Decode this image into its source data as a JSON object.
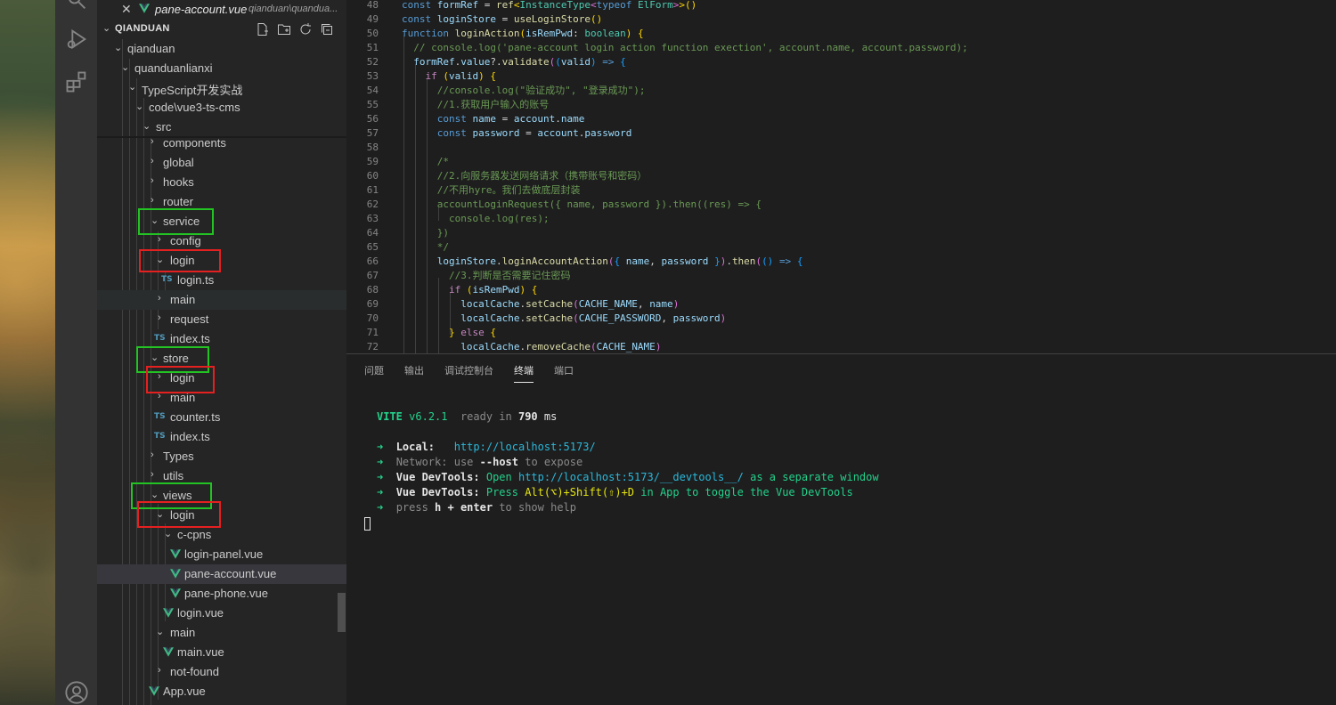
{
  "open_editor": {
    "file_name": "pane-account.vue",
    "file_path": "qianduan\\quandua..."
  },
  "explorer": {
    "root": "QIANDUAN",
    "tree": [
      {
        "label": "qianduan"
      },
      {
        "label": "quanduanlianxi"
      },
      {
        "label": "TypeScript开发实战"
      },
      {
        "label": "code\\vue3-ts-cms"
      },
      {
        "label": "src"
      },
      {
        "label": "components"
      },
      {
        "label": "global"
      },
      {
        "label": "hooks"
      },
      {
        "label": "router"
      },
      {
        "label": "service"
      },
      {
        "label": "config"
      },
      {
        "label": "login"
      },
      {
        "label": "login.ts",
        "icon": "TS"
      },
      {
        "label": "main"
      },
      {
        "label": "request"
      },
      {
        "label": "index.ts",
        "icon": "TS"
      },
      {
        "label": "store"
      },
      {
        "label": "login"
      },
      {
        "label": "main"
      },
      {
        "label": "counter.ts",
        "icon": "TS"
      },
      {
        "label": "index.ts",
        "icon": "TS"
      },
      {
        "label": "Types"
      },
      {
        "label": "utils"
      },
      {
        "label": "views"
      },
      {
        "label": "login"
      },
      {
        "label": "c-cpns"
      },
      {
        "label": "login-panel.vue"
      },
      {
        "label": "pane-account.vue"
      },
      {
        "label": "pane-phone.vue"
      },
      {
        "label": "login.vue"
      },
      {
        "label": "main"
      },
      {
        "label": "main.vue"
      },
      {
        "label": "not-found"
      },
      {
        "label": "App.vue"
      }
    ]
  },
  "editor": {
    "line_numbers": [
      "48",
      "49",
      "50",
      "51",
      "52",
      "53",
      "54",
      "55",
      "56",
      "57",
      "58",
      "59",
      "60",
      "61",
      "62",
      "63",
      "64",
      "65",
      "66",
      "67",
      "68",
      "69",
      "70",
      "71",
      "72"
    ]
  },
  "panel": {
    "tabs": [
      "问题",
      "输出",
      "调试控制台",
      "终端",
      "端口"
    ],
    "active_tab": "终端"
  },
  "terminal": {
    "vite": "VITE",
    "version": "v6.2.1",
    "ready": "ready in",
    "ms_value": "790",
    "ms": "ms",
    "local_label": "Local:",
    "local_url": "http://localhost:5173/",
    "network_label": "Network:",
    "network_use": "use",
    "network_flag": "--host",
    "network_rest": "to expose",
    "devtools_label": "Vue DevTools:",
    "devtools_open": "Open",
    "devtools_url": "http://localhost:5173/__devtools__/",
    "devtools_rest": "as a separate window",
    "devtools2_press": "Press",
    "devtools2_keys": "Alt(⌥)+Shift(⇧)+D",
    "devtools2_rest": "in App to toggle the Vue DevTools",
    "help_press": "press",
    "help_keys": "h + enter",
    "help_rest": "to show help"
  },
  "colors": {
    "highlight_green": "#22c322",
    "highlight_red": "#e52020",
    "vue_green": "#41b883",
    "ts_blue": "#519aba"
  }
}
